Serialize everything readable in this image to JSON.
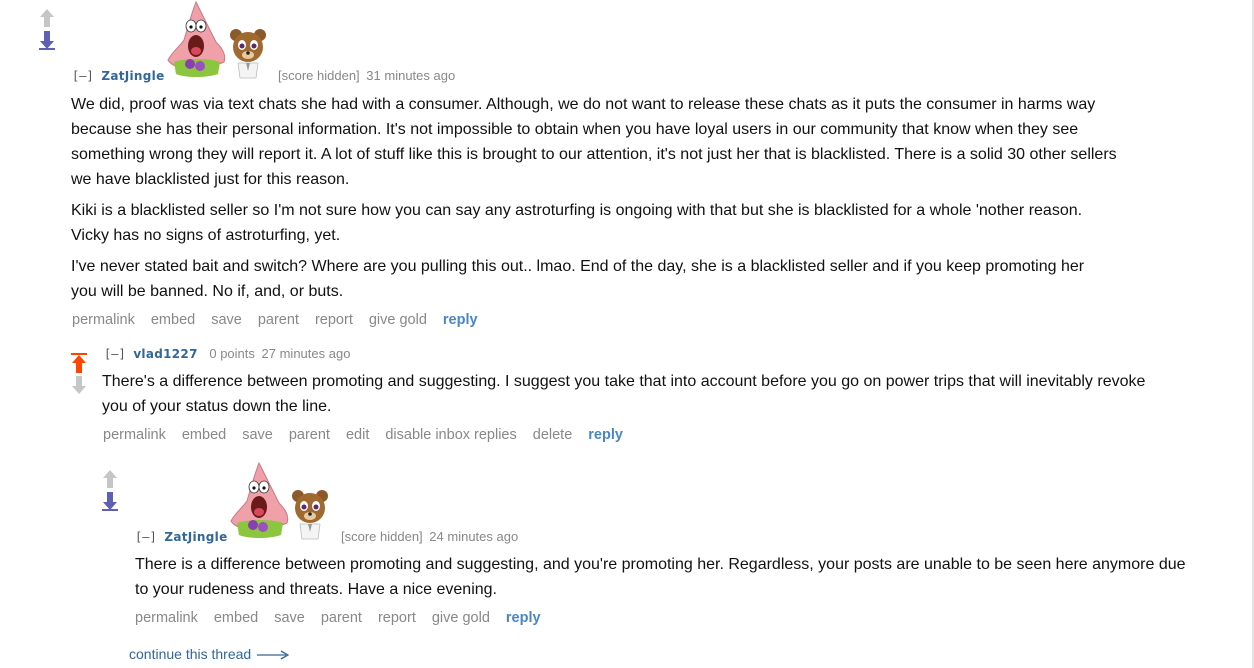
{
  "comments": [
    {
      "collapse": "[–]",
      "author": "ZatJingle",
      "score": "[score hidden]",
      "time": "31 minutes ago",
      "paragraphs": [
        "We did, proof was via text chats she had with a consumer. Although, we do not want to release these chats as it puts the consumer in harms way because she has their personal information. It's not impossible to obtain when you have loyal users in our community that know when they see something wrong they will report it. A lot of stuff like this is brought to our attention, it's not just her that is blacklisted. There is a solid 30 other sellers we have blacklisted just for this reason.",
        "Kiki is a blacklisted seller so I'm not sure how you can say any astroturfing is ongoing with that but she is blacklisted for a whole 'nother reason. Vicky has no signs of astroturfing, yet.",
        "I've never stated bait and switch? Where are you pulling this out.. lmao. End of the day, she is a blacklisted seller and if you keep promoting her you will be banned. No if, and, or buts."
      ],
      "buttons": [
        "permalink",
        "embed",
        "save",
        "parent",
        "report",
        "give gold",
        "reply"
      ]
    },
    {
      "collapse": "[–]",
      "author": "vlad1227",
      "score": "0 points",
      "time": "27 minutes ago",
      "paragraphs": [
        "There's a difference between promoting and suggesting. I suggest you take that into account before you go on power trips that will inevitably revoke you of your status down the line."
      ],
      "buttons": [
        "permalink",
        "embed",
        "save",
        "parent",
        "edit",
        "disable inbox replies",
        "delete",
        "reply"
      ]
    },
    {
      "collapse": "[–]",
      "author": "ZatJingle",
      "score": "[score hidden]",
      "time": "24 minutes ago",
      "paragraphs": [
        "There is a difference between promoting and suggesting, and you're promoting her. Regardless, your posts are unable to be seen here anymore due to your rudeness and threats. Have a nice evening."
      ],
      "buttons": [
        "permalink",
        "embed",
        "save",
        "parent",
        "report",
        "give gold",
        "reply"
      ]
    }
  ],
  "continue_thread": "continue this thread",
  "colors": {
    "upvoted": "#ff4500",
    "downvoted": "#5f5fb8",
    "neutral_arrow": "#c6c6c6",
    "author": "#336699",
    "reply": "#4a86c5",
    "meta": "#888888"
  },
  "icons": {
    "flair_1": "patrick-star-flair-icon",
    "flair_2": "bear-flair-icon"
  }
}
